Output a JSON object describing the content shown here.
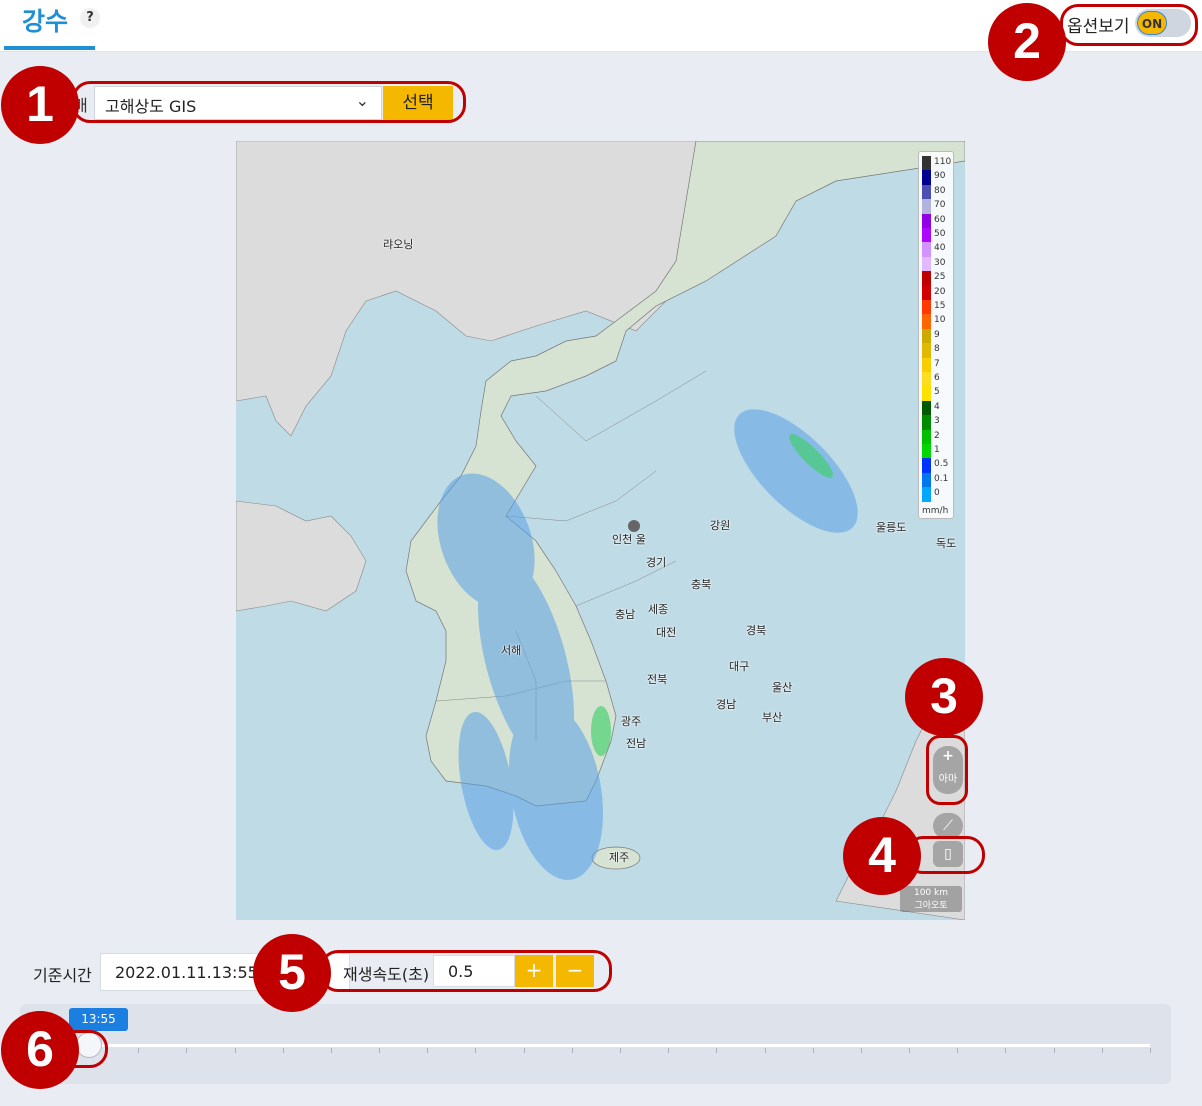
{
  "header": {
    "title": "강수",
    "help_glyph": "?",
    "option_label": "옵션보기",
    "option_toggle": "ON"
  },
  "selector": {
    "prefix": "배",
    "value": "고해상도 GIS",
    "button": "선택"
  },
  "map": {
    "labels": {
      "laoning": "랴오닝",
      "incheon_seoul": "인천 울",
      "gyeonggi": "경기",
      "gangwon": "강원",
      "chungbuk": "충북",
      "chungnam": "충남",
      "sejong": "세종",
      "daejeon": "대전",
      "gyeongbuk": "경북",
      "seohae": "서해",
      "jeonbuk": "전북",
      "daegu": "대구",
      "ulsan": "울산",
      "gwangju": "광주",
      "jeonnam": "전남",
      "gyeongnam": "경남",
      "busan": "부산",
      "jeju": "제주",
      "ulleungdo": "울릉도",
      "dokdo": "독도"
    },
    "legend": {
      "values": [
        "110",
        "90",
        "80",
        "70",
        "60",
        "50",
        "40",
        "30",
        "25",
        "20",
        "15",
        "10",
        "9",
        "8",
        "7",
        "6",
        "5",
        "4",
        "3",
        "2",
        "1",
        "0.5",
        "0.1",
        "0"
      ],
      "colors": [
        "#333333",
        "#000390",
        "#4c4eb1",
        "#b3b4de",
        "#9200e4",
        "#ad07ff",
        "#d292ff",
        "#e0b9ff",
        "#bf0000",
        "#d20000",
        "#ff3700",
        "#ff6600",
        "#ccaa00",
        "#e0b900",
        "#f9cd00",
        "#ffdc1f",
        "#ffe100",
        "#005a00",
        "#008c00",
        "#00be00",
        "#00d600",
        "#0033ff",
        "#0077ee",
        "#00a9ff"
      ],
      "unit": "mm/h"
    },
    "controls": {
      "zoom_in": "+",
      "zoom_out_label": "아마",
      "scale": "100 km",
      "scale_sub": "그아오토"
    }
  },
  "playback": {
    "base_time_label": "기준시간",
    "base_time_value": "2022.01.11.13:55",
    "speed_label": "재생속도(초)",
    "speed_value": "0.5",
    "plus": "+",
    "minus": "−",
    "slider_time": "13:55",
    "slider_progress": 0
  },
  "annotations": [
    "1",
    "2",
    "3",
    "4",
    "5",
    "6"
  ],
  "colors": {
    "accent_blue": "#1f8fd6",
    "button_yellow": "#f5b800",
    "annotation_red": "#c00000",
    "sea": "#bfdbe6",
    "land": "#dde8dc"
  }
}
